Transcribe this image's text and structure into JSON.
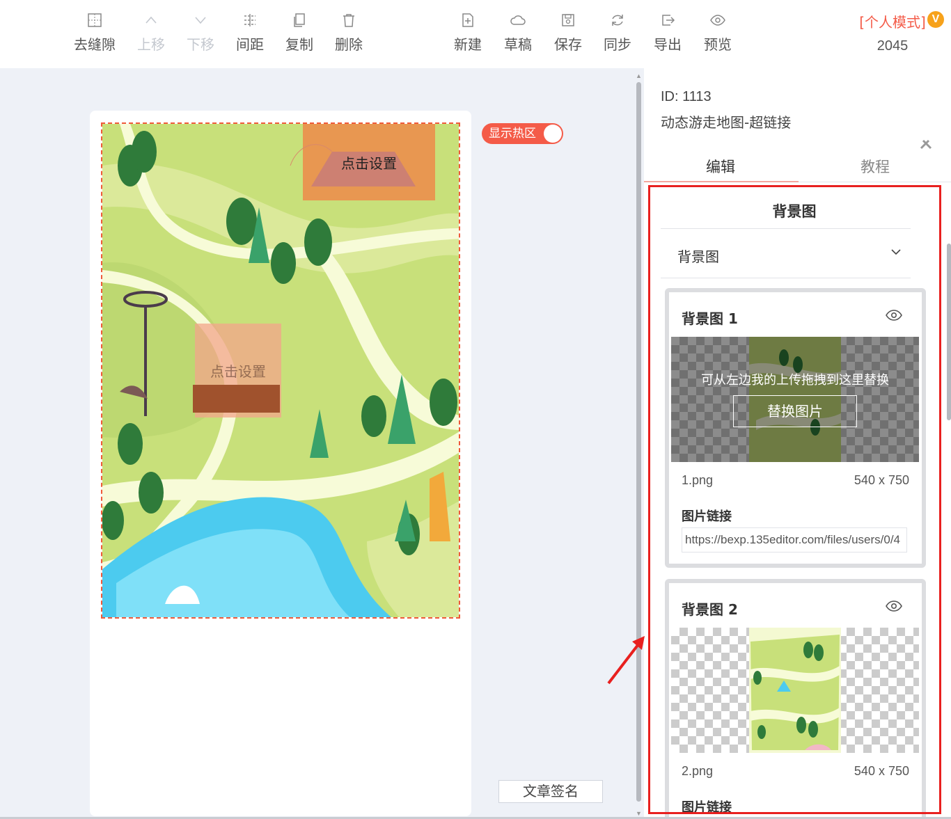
{
  "toolbar": {
    "left_buttons": [
      {
        "label": "去缝隙",
        "icon": "grid-icon",
        "disabled": false
      },
      {
        "label": "上移",
        "icon": "chevron-up-icon",
        "disabled": true
      },
      {
        "label": "下移",
        "icon": "chevron-down-icon",
        "disabled": true
      },
      {
        "label": "间距",
        "icon": "spacing-icon",
        "disabled": false
      },
      {
        "label": "复制",
        "icon": "copy-icon",
        "disabled": false
      },
      {
        "label": "删除",
        "icon": "trash-icon",
        "disabled": false
      }
    ],
    "right_buttons": [
      {
        "label": "新建",
        "icon": "new-file-icon"
      },
      {
        "label": "草稿",
        "icon": "cloud-icon"
      },
      {
        "label": "保存",
        "icon": "save-icon"
      },
      {
        "label": "同步",
        "icon": "sync-icon"
      },
      {
        "label": "导出",
        "icon": "export-icon"
      },
      {
        "label": "预览",
        "icon": "eye-icon"
      }
    ],
    "mode_label": "[个人模式]",
    "vip_badge": "V",
    "count": "2045"
  },
  "canvas": {
    "hotspots": [
      "点击设置",
      "点击设置"
    ],
    "toggle_label": "显示热区",
    "signature_button": "文章签名"
  },
  "panel": {
    "id_text": "ID: 1113",
    "template_name": "动态游走地图-超链接",
    "tabs": [
      {
        "label": "编辑",
        "active": true
      },
      {
        "label": "教程",
        "active": false
      }
    ],
    "section_title": "背景图",
    "dropdown_label": "背景图",
    "cards": [
      {
        "title": "背景图 1",
        "tip": "可从左边我的上传拖拽到这里替换",
        "replace_button": "替换图片",
        "filename": "1.png",
        "size": "540 x 750",
        "link_label": "图片链接",
        "link_value": "https://bexp.135editor.com/files/users/0/4"
      },
      {
        "title": "背景图 2",
        "filename": "2.png",
        "size": "540 x 750",
        "link_label": "图片链接"
      }
    ]
  },
  "colors": {
    "accent": "#f45b48",
    "highlight_box": "#e8201f",
    "grass": "#c8e07a",
    "water": "#4ccbef"
  }
}
